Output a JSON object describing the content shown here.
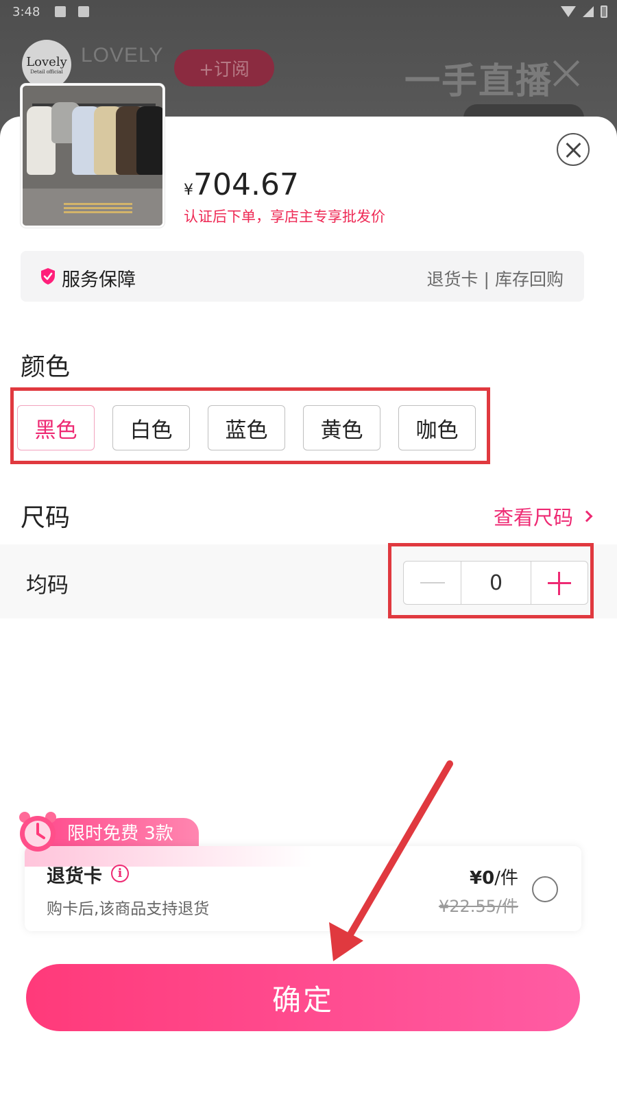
{
  "status_bar": {
    "time": "3:48"
  },
  "live": {
    "store_name": "LOVELY",
    "store_logo": "Lovely",
    "store_logo_sub": "Detail official",
    "subscribe_label": "+订阅",
    "title": "一手直播"
  },
  "product": {
    "price_symbol": "¥",
    "price": "704.67",
    "price_note": "认证后下单，享店主专享批发价"
  },
  "service": {
    "title": "服务保障",
    "items": [
      "退货卡",
      "库存回购"
    ],
    "separator": "|"
  },
  "color_section": {
    "title": "颜色",
    "options": [
      "黑色",
      "白色",
      "蓝色",
      "黄色",
      "咖色"
    ],
    "selected": "黑色"
  },
  "size_section": {
    "title": "尺码",
    "size_link": "查看尺码",
    "size_name": "均码",
    "quantity": "0"
  },
  "return_card": {
    "promo": "限时免费 3款",
    "title": "退货卡",
    "description": "购卡后,该商品支持退货",
    "price": "¥0",
    "unit": "/件",
    "original_price": "¥22.55/件"
  },
  "confirm_label": "确定",
  "colors": {
    "accent": "#ee2a73",
    "annotation_red": "#e0393f",
    "button_gradient_start": "#ff3a7a",
    "button_gradient_end": "#ff5ca3"
  }
}
